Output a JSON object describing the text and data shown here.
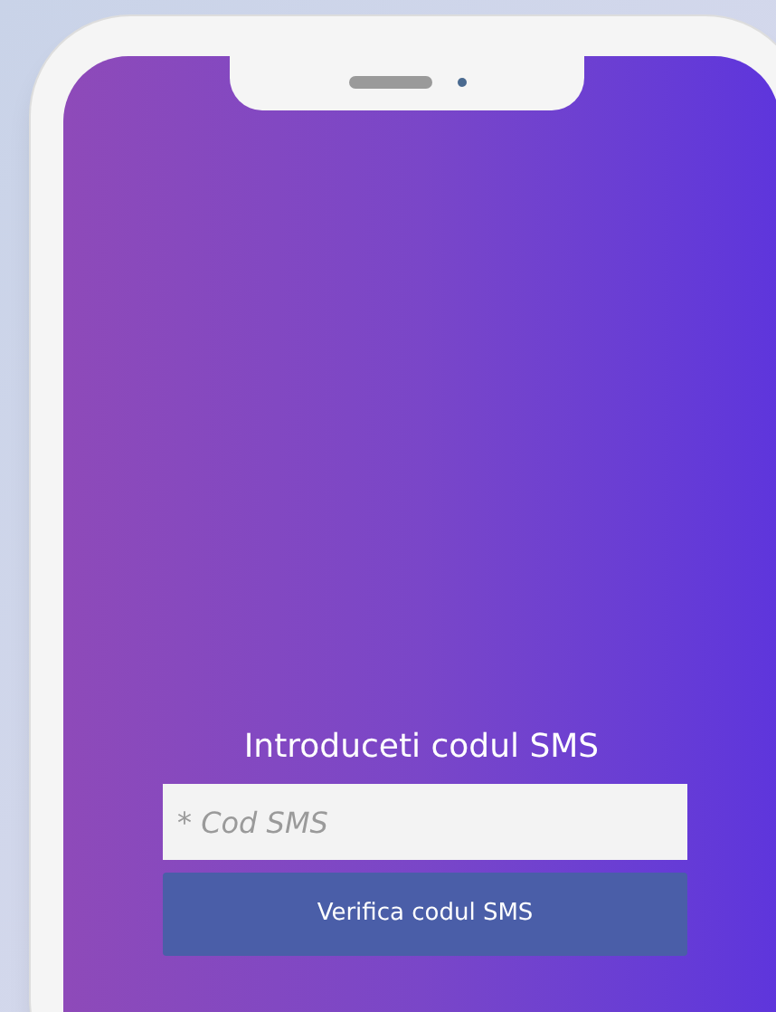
{
  "screen": {
    "title": "Introduceti codul SMS",
    "code_field": {
      "placeholder": "* Cod SMS"
    },
    "verify_button": {
      "label": "Verifica codul SMS"
    }
  }
}
